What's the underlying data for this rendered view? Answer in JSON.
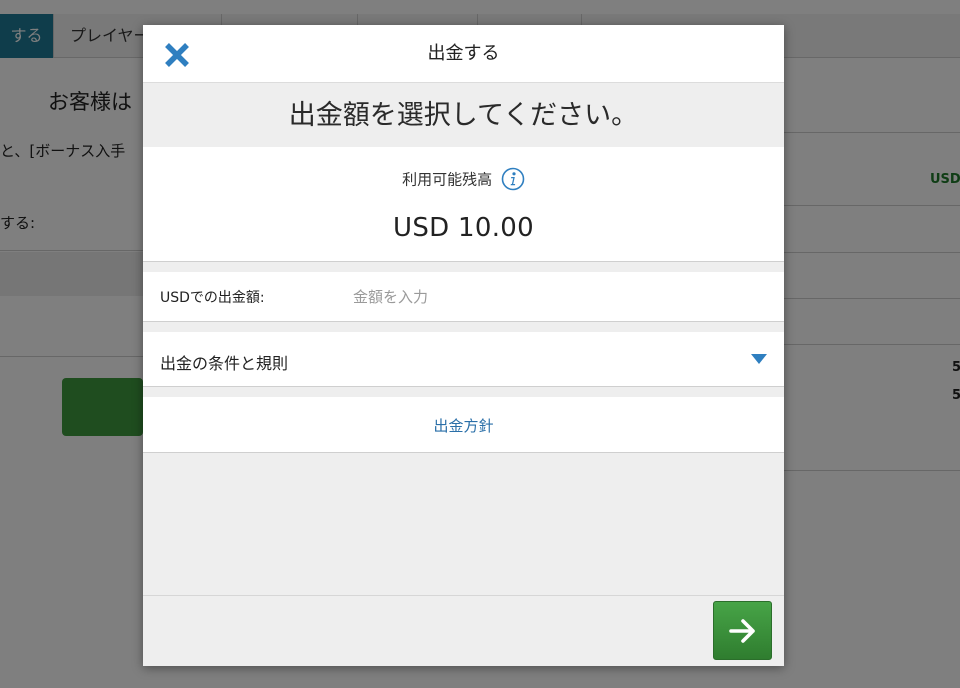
{
  "background": {
    "tabs": [
      {
        "label": "する",
        "active": true
      },
      {
        "label": "プレイヤー",
        "active": false
      }
    ],
    "title": "お客様は",
    "text_1": "と、[ボーナス入手",
    "text_2": "する:",
    "side_usd": "USD",
    "side_value_1": "5",
    "side_value_2": "5"
  },
  "modal": {
    "title": "出金する",
    "prompt": "出金額を選択してください。",
    "balance": {
      "label": "利用可能残高",
      "value": "USD 10.00"
    },
    "amount": {
      "label": "USDでの出金額:",
      "placeholder": "金額を入力",
      "value": ""
    },
    "terms_label": "出金の条件と規則",
    "policy_link": "出金方針"
  },
  "colors": {
    "accent_blue": "#2f7fc0",
    "link_blue": "#2a6fa8",
    "next_green": "#3f9a3f",
    "active_tab": "#1f7b96"
  },
  "icons": {
    "close": "close-icon",
    "info": "info-icon",
    "dropdown": "chevron-down-icon",
    "next": "arrow-right-icon"
  }
}
